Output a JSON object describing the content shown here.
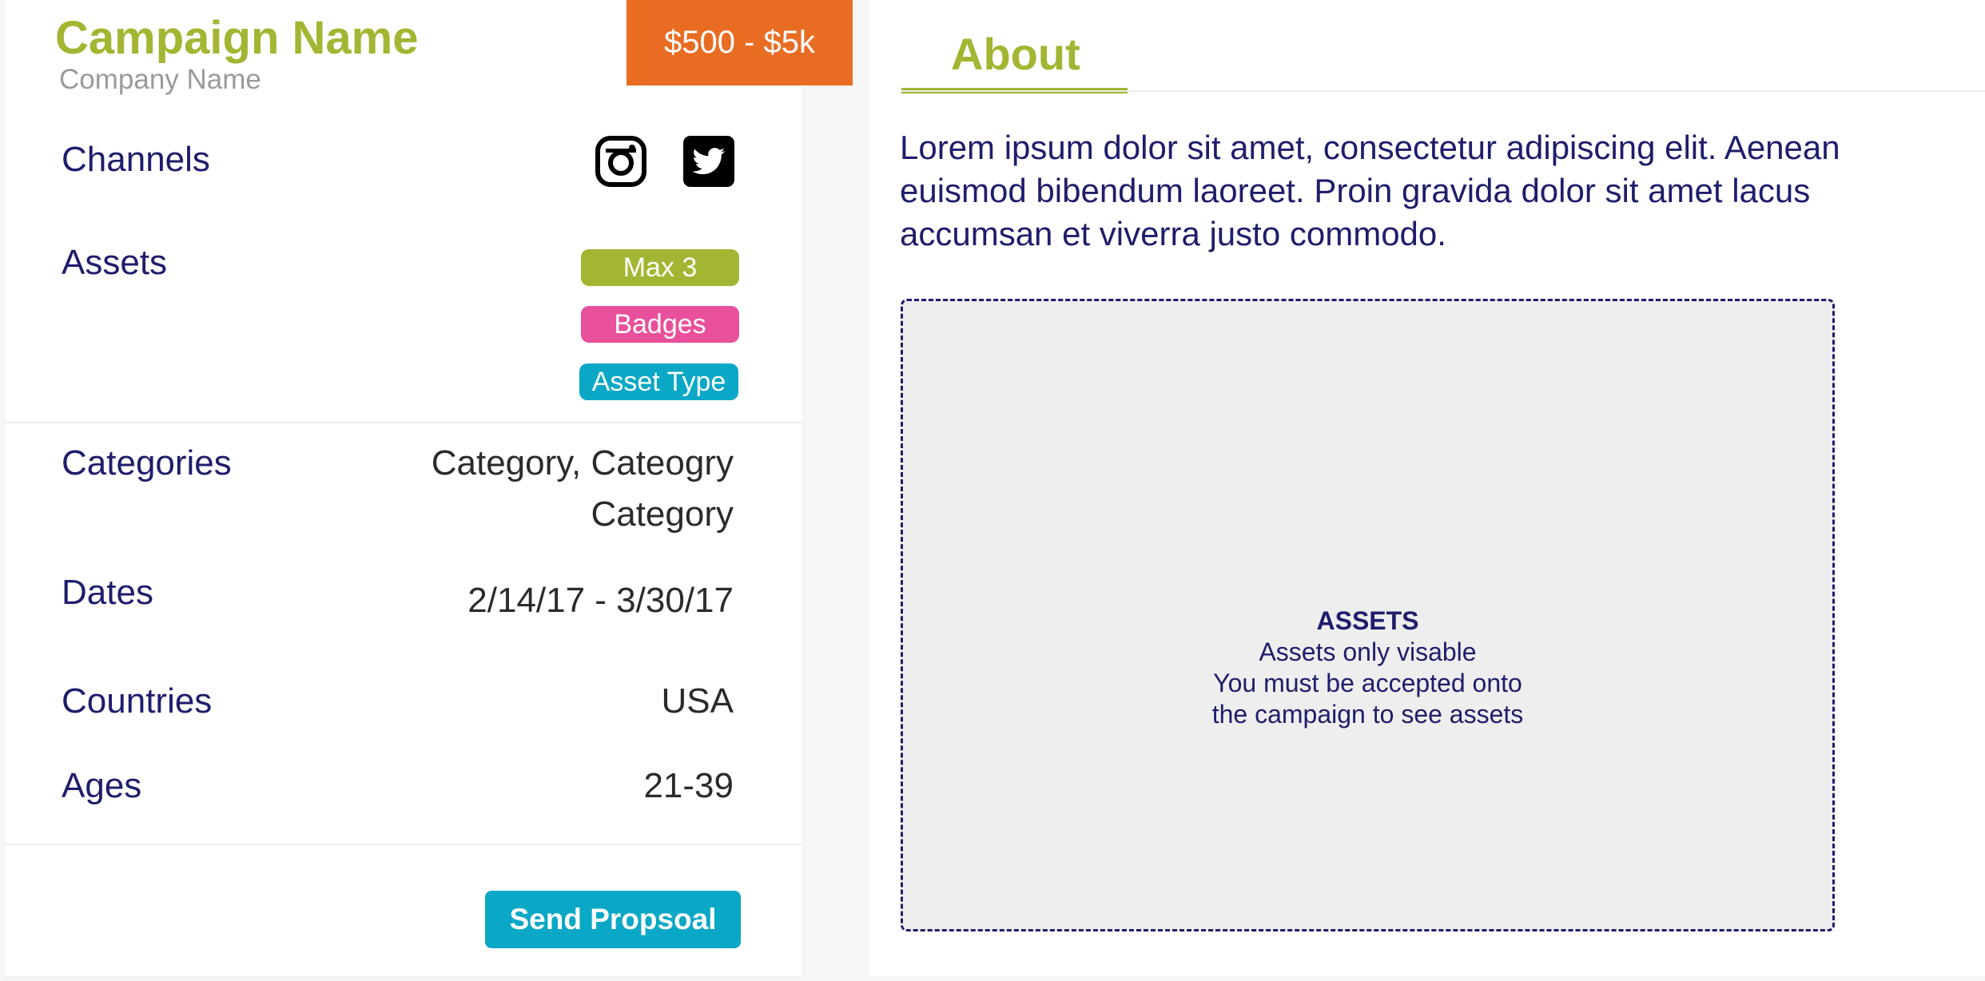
{
  "campaign": {
    "title": "Campaign Name",
    "company": "Company Name",
    "budget": "$500 - $5k"
  },
  "details": {
    "channels_label": "Channels",
    "channels": [
      {
        "icon": "instagram-icon"
      },
      {
        "icon": "twitter-icon"
      }
    ],
    "assets_label": "Assets",
    "asset_pills": [
      {
        "label": "Max 3",
        "color": "#a3b532"
      },
      {
        "label": "Badges",
        "color": "#e9509b"
      },
      {
        "label": "Asset Type",
        "color": "#0aa8c6"
      }
    ],
    "categories_label": "Categories",
    "categories_line1": "Category, Cateogry",
    "categories_line2": "Category",
    "dates_label": "Dates",
    "dates_value": "2/14/17 - 3/30/17",
    "countries_label": "Countries",
    "countries_value": "USA",
    "ages_label": "Ages",
    "ages_value": "21-39"
  },
  "actions": {
    "send_label": "Send Propsoal"
  },
  "about": {
    "tab_label": "About",
    "body": "Lorem ipsum dolor sit amet, consectetur adipiscing elit. Aenean euismod bibendum laoreet. Proin gravida dolor sit amet lacus accumsan et viverra justo commodo.",
    "assets_title": "ASSETS",
    "assets_line1": "Assets only visable",
    "assets_line2": "You must be accepted onto",
    "assets_line3": "the campaign to see assets"
  },
  "colors": {
    "brand_green": "#a3b532",
    "brand_orange": "#e86c22",
    "brand_navy": "#1f1d6b",
    "brand_teal": "#0aa8c6",
    "brand_pink": "#e9509b"
  }
}
